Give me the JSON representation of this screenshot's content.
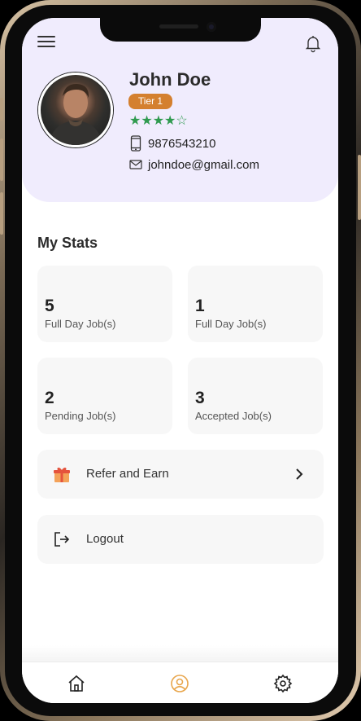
{
  "header": {
    "menu_icon": "hamburger-menu-icon",
    "notification_icon": "bell-icon"
  },
  "profile": {
    "name": "John Doe",
    "tier": "Tier 1",
    "rating": 4,
    "rating_max": 5,
    "phone": "9876543210",
    "email": "johndoe@gmail.com"
  },
  "stats": {
    "title": "My Stats",
    "cards": [
      {
        "value": "5",
        "label": "Full Day Job(s)"
      },
      {
        "value": "1",
        "label": "Full Day Job(s)"
      },
      {
        "value": "2",
        "label": "Pending Job(s)"
      },
      {
        "value": "3",
        "label": "Accepted Job(s)"
      }
    ]
  },
  "actions": {
    "refer": {
      "label": "Refer and Earn",
      "icon": "gift-icon"
    },
    "logout": {
      "label": "Logout",
      "icon": "logout-icon"
    }
  },
  "bottom_nav": {
    "items": [
      {
        "icon": "home-icon",
        "active": false
      },
      {
        "icon": "profile-icon",
        "active": true
      },
      {
        "icon": "settings-icon",
        "active": false
      }
    ]
  },
  "colors": {
    "header_bg": "#f0ecfd",
    "tier_badge": "#d4802f",
    "stars": "#2f9a4f",
    "active_nav": "#e8a54b"
  }
}
